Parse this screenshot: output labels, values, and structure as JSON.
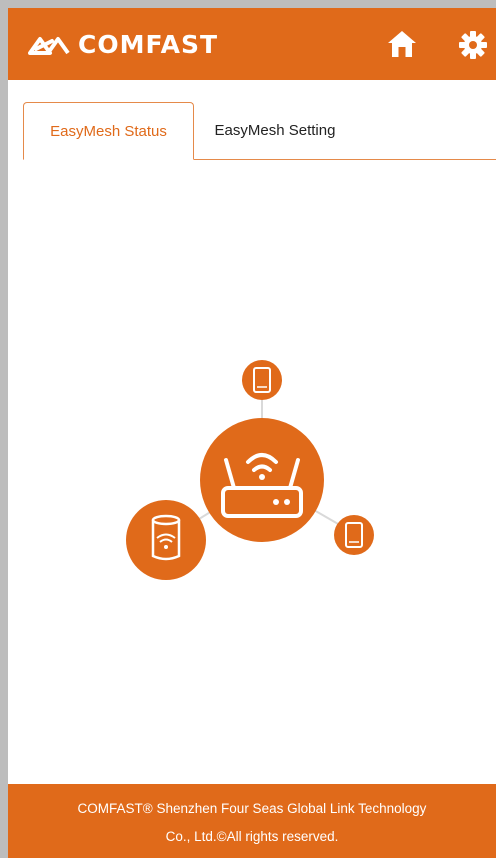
{
  "header": {
    "brand": "COMFAST",
    "home_icon": "home-icon",
    "settings_icon": "gear-icon",
    "color": "#e06a1a"
  },
  "tabs": [
    {
      "label": "EasyMesh Status",
      "active": true
    },
    {
      "label": "EasyMesh Setting",
      "active": false
    }
  ],
  "topology": {
    "center_icon": "router-icon",
    "nodes": [
      "phone-icon",
      "phone-icon",
      "mesh-satellite-icon"
    ]
  },
  "footer": {
    "line1": "COMFAST® Shenzhen Four Seas Global Link Technology",
    "line2": "Co., Ltd.©All rights reserved."
  },
  "colors": {
    "accent": "#e06a1a",
    "background": "#ffffff",
    "frame": "#bdbdbd"
  }
}
